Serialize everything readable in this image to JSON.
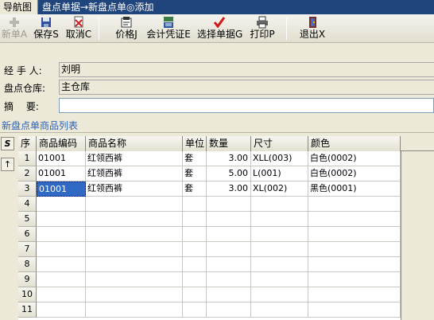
{
  "tabs": {
    "nav": "导航图",
    "active": "盘点单据→新盘点单◎添加"
  },
  "toolbar": {
    "buttons": [
      {
        "label": "新单A",
        "icon": "plus-icon",
        "enabled": false
      },
      {
        "label": "保存S",
        "icon": "floppy-icon",
        "enabled": true
      },
      {
        "label": "取消C",
        "icon": "cancel-doc-icon",
        "enabled": true
      },
      {
        "label": "价格J",
        "icon": "price-icon",
        "enabled": true
      },
      {
        "label": "会计凭证E",
        "icon": "voucher-icon",
        "enabled": true
      },
      {
        "label": "选择单据G",
        "icon": "checkmark-icon",
        "enabled": true
      },
      {
        "label": "打印P",
        "icon": "printer-icon",
        "enabled": true
      },
      {
        "label": "退出X",
        "icon": "exit-door-icon",
        "enabled": true
      }
    ]
  },
  "form": {
    "handler_label": "经 手 人:",
    "handler_value": "刘明",
    "warehouse_label": "盘点仓库:",
    "warehouse_value": "主仓库",
    "memo_label": "摘　 要:",
    "memo_value": ""
  },
  "section_title": "新盘点单商品列表",
  "side_tools": [
    {
      "icon": "s-curve-icon",
      "glyph": "S"
    },
    {
      "icon": "upload-arrow-icon",
      "glyph": "↑"
    }
  ],
  "grid": {
    "columns": [
      "序",
      "商品编码",
      "商品名称",
      "单位",
      "数量",
      "尺寸",
      "颜色"
    ],
    "rows": [
      {
        "no": "1",
        "code": "01001",
        "name": "红领西裤",
        "unit": "套",
        "qty": "3.00",
        "size": "XLL(003)",
        "color": "白色(0002)"
      },
      {
        "no": "2",
        "code": "01001",
        "name": "红领西裤",
        "unit": "套",
        "qty": "5.00",
        "size": "L(001)",
        "color": "白色(0002)"
      },
      {
        "no": "3",
        "code": "01001",
        "name": "红领西裤",
        "unit": "套",
        "qty": "3.00",
        "size": "XL(002)",
        "color": "黑色(0001)"
      },
      {
        "no": "4",
        "code": "",
        "name": "",
        "unit": "",
        "qty": "",
        "size": "",
        "color": ""
      },
      {
        "no": "5",
        "code": "",
        "name": "",
        "unit": "",
        "qty": "",
        "size": "",
        "color": ""
      },
      {
        "no": "6",
        "code": "",
        "name": "",
        "unit": "",
        "qty": "",
        "size": "",
        "color": ""
      },
      {
        "no": "7",
        "code": "",
        "name": "",
        "unit": "",
        "qty": "",
        "size": "",
        "color": ""
      },
      {
        "no": "8",
        "code": "",
        "name": "",
        "unit": "",
        "qty": "",
        "size": "",
        "color": ""
      },
      {
        "no": "9",
        "code": "",
        "name": "",
        "unit": "",
        "qty": "",
        "size": "",
        "color": ""
      },
      {
        "no": "10",
        "code": "",
        "name": "",
        "unit": "",
        "qty": "",
        "size": "",
        "color": ""
      },
      {
        "no": "11",
        "code": "",
        "name": "",
        "unit": "",
        "qty": "",
        "size": "",
        "color": ""
      }
    ]
  },
  "colors": {
    "tab_bar": "#20457c",
    "section_title": "#2e63b6",
    "selection": "#316ac5",
    "window_bg": "#ece9d8"
  }
}
